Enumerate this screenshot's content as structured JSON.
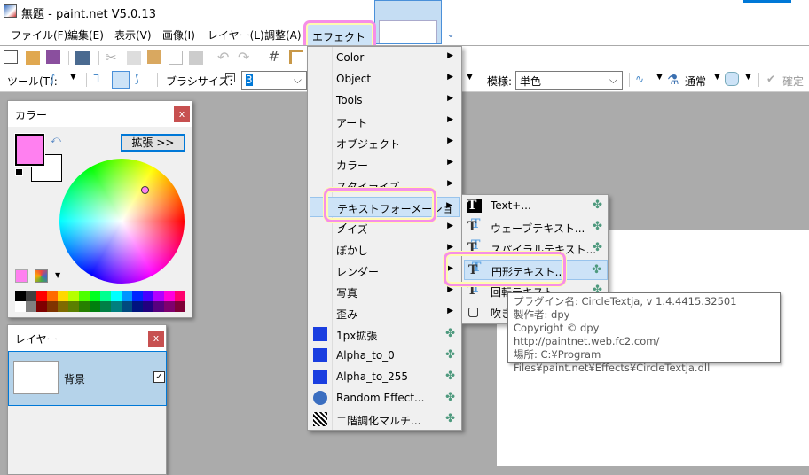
{
  "window": {
    "title": "無題 - paint.net V5.0.13"
  },
  "menubar": [
    "ファイル(F)",
    "編集(E)",
    "表示(V)",
    "画像(I)",
    "レイヤー(L)",
    "調整(A)",
    "エフェクト(C)"
  ],
  "toolbar": {
    "tool_label": "ツール(T):",
    "brush_size_label": "ブラシサイズ:",
    "brush_size": "3",
    "pattern_label": "模様:",
    "pattern": "単色",
    "blend_mode": "通常",
    "confirm": "確定"
  },
  "color_panel": {
    "title": "カラー",
    "expand": "拡張 >>",
    "primary": "#ff80f0",
    "secondary": "#ffffff",
    "palette_top": [
      "#000000",
      "#404040",
      "#ff0000",
      "#ff6a00",
      "#ffd800",
      "#b6ff00",
      "#4cff00",
      "#00ff21",
      "#00ff90",
      "#00ffff",
      "#0094ff",
      "#0026ff",
      "#4800ff",
      "#b200ff",
      "#ff00dc",
      "#ff006e"
    ],
    "palette_bottom": [
      "#ffffff",
      "#808080",
      "#7f0000",
      "#7f3300",
      "#7f6a00",
      "#5b7f00",
      "#267f00",
      "#007f0e",
      "#007f46",
      "#007f7f",
      "#004a7f",
      "#00137f",
      "#21007f",
      "#57007f",
      "#7f006e",
      "#7f0037"
    ]
  },
  "layer_panel": {
    "title": "レイヤー",
    "layers": [
      {
        "name": "背景",
        "visible": true
      }
    ]
  },
  "effects_menu": [
    {
      "label": "Color",
      "sub": true
    },
    {
      "label": "Object",
      "sub": true
    },
    {
      "label": "Tools",
      "sub": true
    },
    {
      "label": "アート",
      "sub": true
    },
    {
      "label": "オブジェクト",
      "sub": true
    },
    {
      "label": "カラー",
      "sub": true
    },
    {
      "label": "スタイライズ",
      "sub": true
    },
    {
      "label": "テキストフォーメーション",
      "sub": true,
      "active": true
    },
    {
      "label": "ノイズ",
      "sub": true
    },
    {
      "label": "ぼかし",
      "sub": true
    },
    {
      "label": "レンダー",
      "sub": true
    },
    {
      "label": "写真",
      "sub": true
    },
    {
      "label": "歪み",
      "sub": true
    },
    {
      "label": "1px拡張",
      "plugin": true
    },
    {
      "label": "Alpha_to_0",
      "plugin": true
    },
    {
      "label": "Alpha_to_255",
      "plugin": true
    },
    {
      "label": "Random Effect...",
      "plugin": true
    },
    {
      "label": "二階調化マルチ...",
      "plugin": true
    }
  ],
  "text_submenu": [
    {
      "label": "Text+..."
    },
    {
      "label": "ウェーブテキスト..."
    },
    {
      "label": "スパイラルテキスト..."
    },
    {
      "label": "円形テキスト...",
      "active": true
    },
    {
      "label": "回転テキスト..."
    },
    {
      "label": "吹き出し..."
    }
  ],
  "tooltip": [
    "プラグイン名: CircleTextja, v 1.4.4415.32501",
    "製作者: dpy",
    "Copyright © dpy",
    "http://paintnet.web.fc2.com/",
    "場所: C:¥Program Files¥paint.net¥Effects¥CircleTextja.dll"
  ]
}
